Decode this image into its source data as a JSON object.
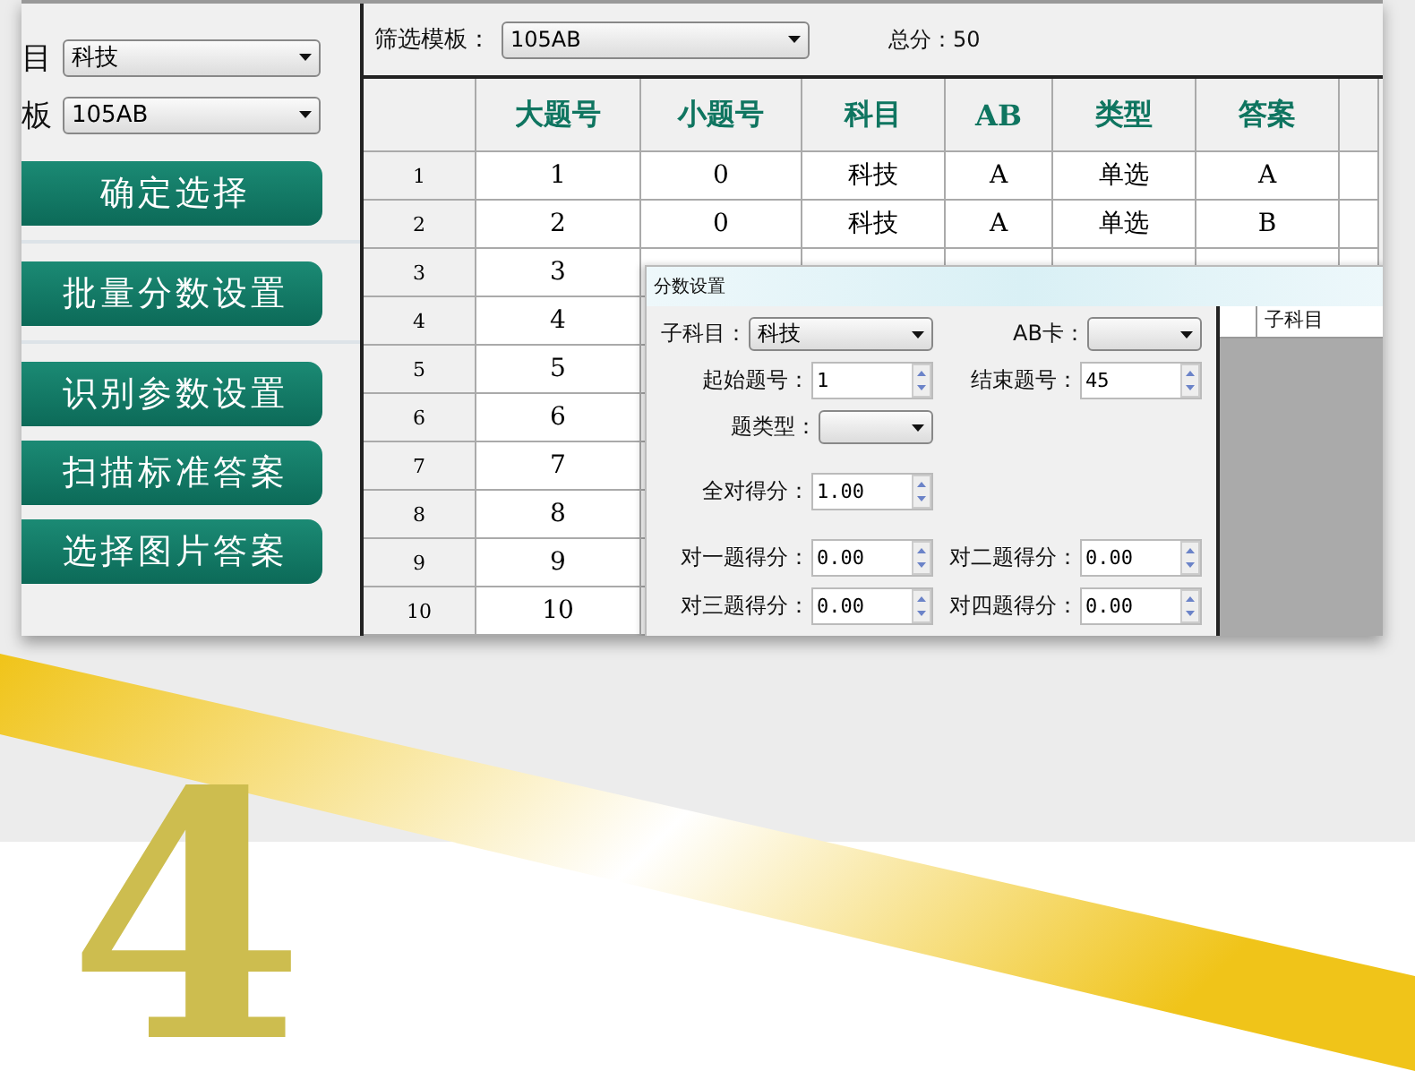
{
  "left_panel": {
    "fields": [
      {
        "label": "目",
        "value": "科技"
      },
      {
        "label": "板",
        "value": "105AB"
      }
    ],
    "button_groups": [
      [
        "确定选择"
      ],
      [
        "批量分数设置"
      ],
      [
        "识别参数设置",
        "扫描标准答案",
        "选择图片答案"
      ]
    ]
  },
  "toolbar": {
    "filter_label": "筛选模板：",
    "filter_value": "105AB",
    "total": "总分：50"
  },
  "table": {
    "columns": [
      "大题号",
      "小题号",
      "科目",
      "AB",
      "类型",
      "答案"
    ],
    "rows": [
      {
        "number": "1",
        "cells": [
          "1",
          "0",
          "科技",
          "A",
          "单选",
          "A"
        ]
      },
      {
        "number": "2",
        "cells": [
          "2",
          "0",
          "科技",
          "A",
          "单选",
          "B"
        ]
      },
      {
        "number": "3",
        "cells": [
          "3"
        ]
      },
      {
        "number": "4",
        "cells": [
          "4"
        ]
      },
      {
        "number": "5",
        "cells": [
          "5"
        ]
      },
      {
        "number": "6",
        "cells": [
          "6"
        ]
      },
      {
        "number": "7",
        "cells": [
          "7"
        ]
      },
      {
        "number": "8",
        "cells": [
          "8"
        ]
      },
      {
        "number": "9",
        "cells": [
          "9"
        ]
      },
      {
        "number": "10",
        "cells": [
          "10"
        ]
      }
    ]
  },
  "dialog": {
    "title": "分数设置",
    "rows": [
      [
        {
          "kind": "select",
          "label": "子科目：",
          "value": "科技",
          "wide": true
        },
        {
          "kind": "select",
          "label": "AB卡："
        }
      ],
      [
        {
          "kind": "spin",
          "label": "起始题号：",
          "value": "1"
        },
        {
          "kind": "spin",
          "label": "结束题号：",
          "value": "45"
        }
      ],
      [
        {
          "kind": "select",
          "label": "题类型："
        }
      ],
      [
        {
          "kind": "spin",
          "label": "全对得分：",
          "value": "1.00"
        }
      ],
      [
        {
          "kind": "spin",
          "label": "对一题得分：",
          "value": "0.00"
        },
        {
          "kind": "spin",
          "label": "对二题得分：",
          "value": "0.00"
        }
      ],
      [
        {
          "kind": "spin",
          "label": "对三题得分：",
          "value": "0.00"
        },
        {
          "kind": "spin",
          "label": "对四题得分：",
          "value": "0.00"
        }
      ]
    ],
    "grid_header": "子科目"
  },
  "step_number": "4"
}
